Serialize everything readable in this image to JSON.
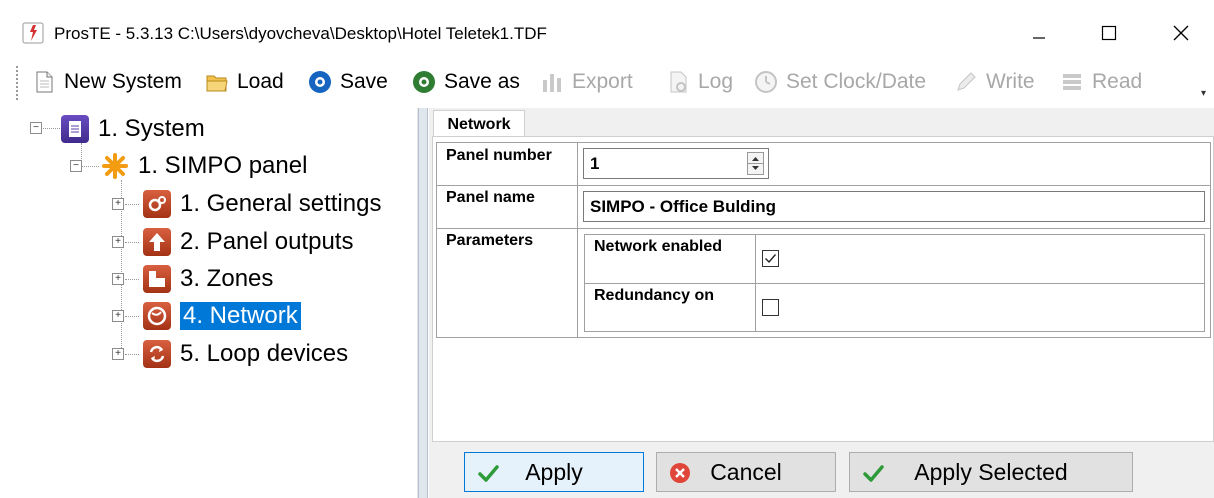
{
  "window": {
    "title": "ProsTE - 5.3.13 C:\\Users\\dyovcheva\\Desktop\\Hotel Teletek1.TDF",
    "minimize_glyph": "—",
    "maximize_glyph": "☐",
    "close_glyph": "✕"
  },
  "toolbar": {
    "new_system": "New System",
    "load": "Load",
    "save": "Save",
    "save_as": "Save as",
    "export": "Export",
    "log": "Log",
    "set_clock": "Set Clock/Date",
    "write": "Write",
    "read": "Read"
  },
  "tree": {
    "system": "1. System",
    "panel": "1. SIMPO panel",
    "items": [
      {
        "label": "1. General settings",
        "icon": "gears-icon"
      },
      {
        "label": "2. Panel outputs",
        "icon": "arrow-up-icon"
      },
      {
        "label": "3. Zones",
        "icon": "zones-icon"
      },
      {
        "label": "4. Network",
        "icon": "globe-icon"
      },
      {
        "label": "5. Loop devices",
        "icon": "loop-icon"
      }
    ],
    "selected_index": 3
  },
  "tab": {
    "label": "Network"
  },
  "form": {
    "panel_number_label": "Panel number",
    "panel_number_value": "1",
    "panel_name_label": "Panel name",
    "panel_name_value": "SIMPO - Office Bulding",
    "parameters_label": "Parameters",
    "network_enabled_label": "Network enabled",
    "network_enabled": true,
    "redundancy_label": "Redundancy on",
    "redundancy_on": false
  },
  "buttons": {
    "apply": "Apply",
    "cancel": "Cancel",
    "apply_selected": "Apply Selected"
  },
  "colors": {
    "selection": "#0078d7",
    "tree_icon_red": "#b8431f",
    "splitter": "#dfe6ee"
  }
}
